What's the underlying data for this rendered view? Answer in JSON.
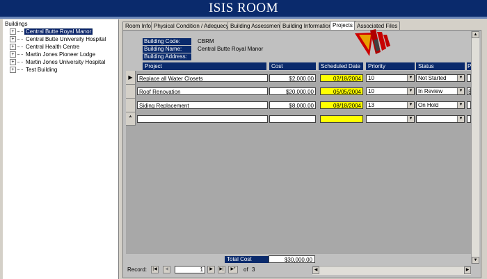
{
  "app": {
    "title": "ISIS ROOM"
  },
  "tree": {
    "title": "Buildings",
    "items": [
      {
        "label": "Central Butte Royal Manor",
        "selected": true
      },
      {
        "label": "Central Butte University Hospital"
      },
      {
        "label": "Central Health Centre"
      },
      {
        "label": "Martin Jones Pioneer Lodge"
      },
      {
        "label": "Martin Jones University Hospital"
      },
      {
        "label": "Test Building"
      }
    ]
  },
  "tabs": [
    {
      "label": "Room Info"
    },
    {
      "label": "Physical Condition / Adequecy"
    },
    {
      "label": "Building Assessment"
    },
    {
      "label": "Building Information"
    },
    {
      "label": "Projects",
      "active": true
    },
    {
      "label": "Associated Files"
    }
  ],
  "building": {
    "code_label": "Building Code:",
    "code_value": "CBRM",
    "name_label": "Building Name:",
    "name_value": "Central Butte Royal Manor",
    "address_label": "Building Address:",
    "address_value": ""
  },
  "columns": [
    "Project",
    "Cost",
    "Scheduled Date",
    "Priority",
    "Status",
    "P"
  ],
  "projects": [
    {
      "project": "Replace all Water Closets",
      "cost": "$2,000.00",
      "date": "02/18/2004",
      "priority": "10",
      "status": "Not Started",
      "extra": ""
    },
    {
      "project": "Roof Renovation",
      "cost": "$20,000.00",
      "date": "05/05/2004",
      "priority": "10",
      "status": "In Review",
      "extra": "B"
    },
    {
      "project": "Siding Replacement",
      "cost": "$8,000.00",
      "date": "08/18/2004",
      "priority": "13",
      "status": "On Hold",
      "extra": ""
    }
  ],
  "new_row_marker": "*",
  "current_row_marker": "▶",
  "total": {
    "label": "Total Cost",
    "value": "$30,000.00"
  },
  "navigation": {
    "label": "Record:",
    "current": "1",
    "of_label": "of",
    "count": "3"
  },
  "icons": {
    "logo": "red-arrow-stripes-icon"
  },
  "colors": {
    "header_bg": "#0a2a6c",
    "highlight": "#ffff00"
  }
}
